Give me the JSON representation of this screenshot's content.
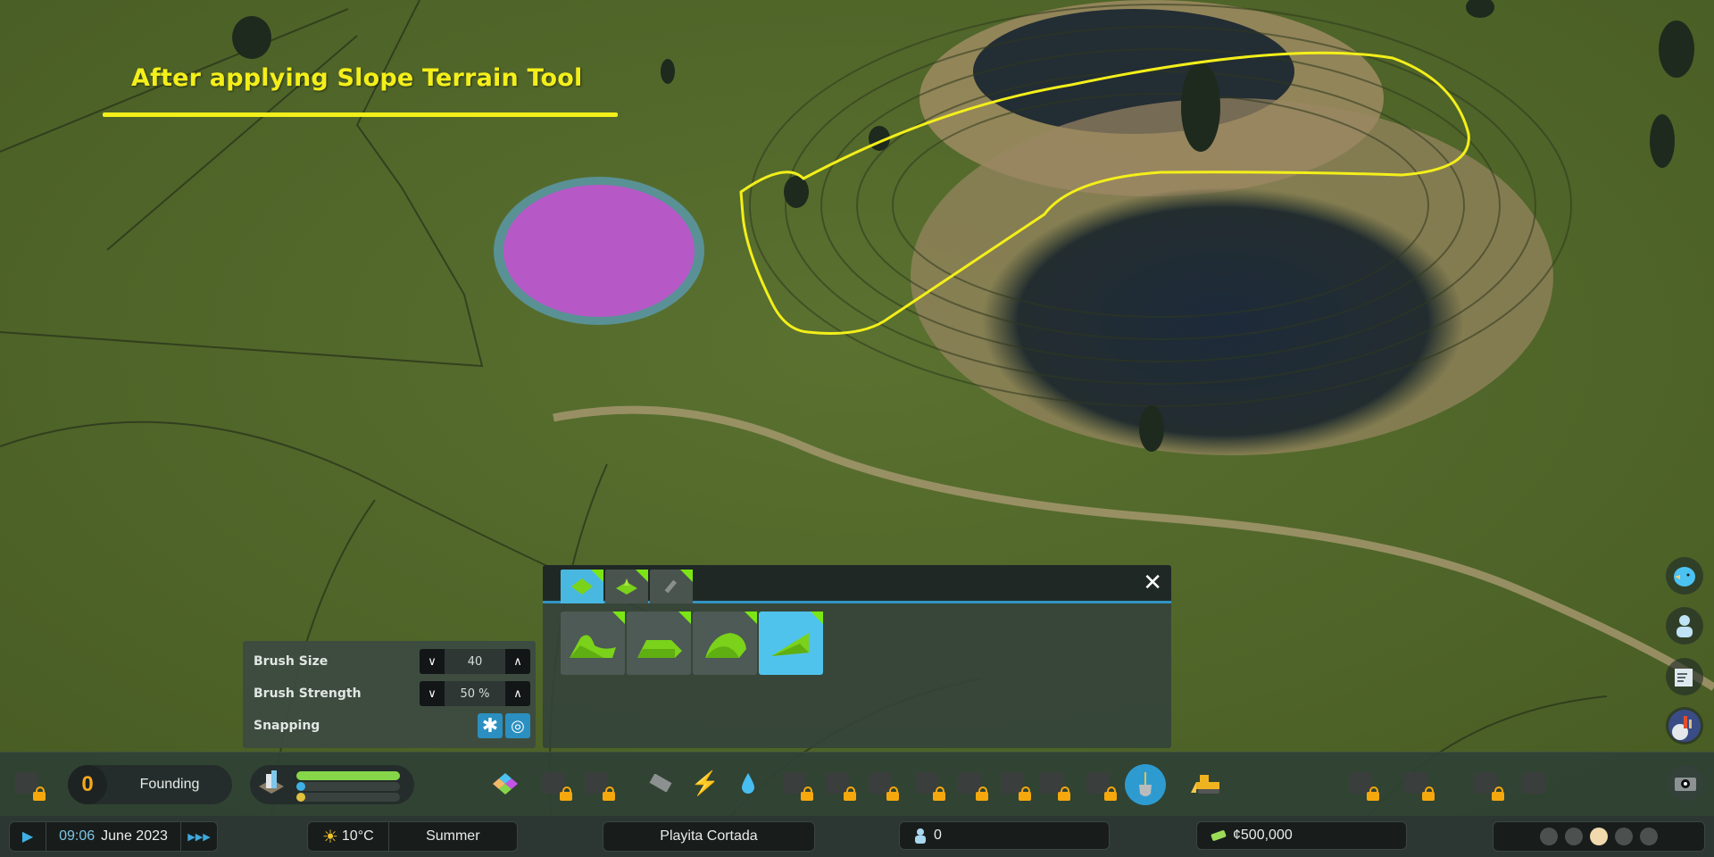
{
  "annotation": {
    "title": "After applying Slope Terrain Tool",
    "color": "#f4ef1a"
  },
  "brush_settings": {
    "brush_size": {
      "label": "Brush Size",
      "value": "40"
    },
    "brush_strength": {
      "label": "Brush Strength",
      "value": "50 %"
    },
    "snapping": {
      "label": "Snapping",
      "options": [
        "snap-all-icon",
        "snap-contour-icon"
      ]
    }
  },
  "terrain_panel": {
    "tabs": [
      {
        "name": "terrain-tools-tab",
        "active": true
      },
      {
        "name": "resources-tab",
        "active": false
      },
      {
        "name": "surfaces-tab",
        "active": false
      }
    ],
    "brushes": [
      {
        "name": "shift-terrain-brush",
        "active": false
      },
      {
        "name": "level-terrain-brush",
        "active": false
      },
      {
        "name": "soften-terrain-brush",
        "active": false
      },
      {
        "name": "slope-terrain-brush",
        "active": true
      }
    ],
    "close_icon": "close-icon"
  },
  "right_side": [
    "chirper-icon",
    "citizens-icon",
    "journal-icon",
    "city-info-icon"
  ],
  "toolbar": {
    "milestone": {
      "level": "0",
      "label": "Founding"
    },
    "progress": {
      "fill_fraction": 1.0
    },
    "tools": [
      {
        "name": "zoning-icon",
        "locked": false
      },
      {
        "name": "areas-icon",
        "locked": true
      },
      {
        "name": "landscaping-icon",
        "locked": true
      },
      {
        "name": "roads-icon",
        "locked": false
      },
      {
        "name": "electricity-icon",
        "locked": false
      },
      {
        "name": "water-icon",
        "locked": false
      },
      {
        "name": "healthcare-icon",
        "locked": true
      },
      {
        "name": "garbage-icon",
        "locked": true
      },
      {
        "name": "education-icon",
        "locked": true
      },
      {
        "name": "fire-rescue-icon",
        "locked": true
      },
      {
        "name": "police-icon",
        "locked": true
      },
      {
        "name": "transportation-icon",
        "locked": true
      },
      {
        "name": "parks-icon",
        "locked": true
      },
      {
        "name": "communications-icon",
        "locked": true
      },
      {
        "name": "terraform-shovel-icon",
        "locked": false,
        "active": true
      },
      {
        "name": "bulldozer-icon",
        "locked": false
      }
    ],
    "right_tools": [
      {
        "name": "transport-overview-icon",
        "locked": true
      },
      {
        "name": "area-overview-icon",
        "locked": true
      },
      {
        "name": "progression-icon",
        "locked": true
      },
      {
        "name": "disaster-icon",
        "locked": false
      }
    ],
    "camera_icon": "camera-icon"
  },
  "bottombar": {
    "time": "09:06",
    "date": "June 2023",
    "temperature": "10°C",
    "season": "Summer",
    "city_name": "Playita Cortada",
    "population": "0",
    "money": "¢500,000",
    "happiness_level": 3
  }
}
